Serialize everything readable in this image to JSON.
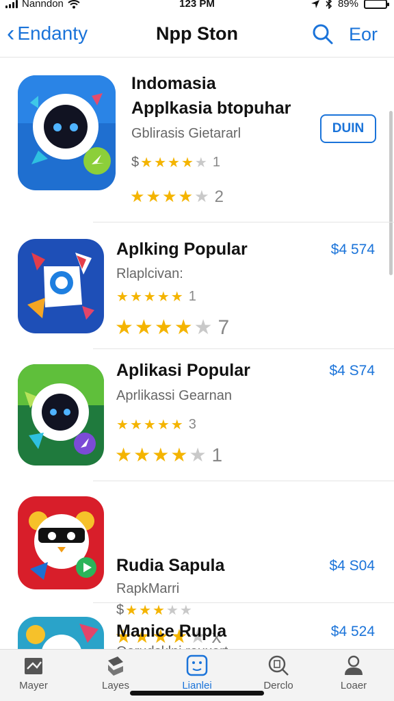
{
  "status": {
    "carrier": "Nanndon",
    "time": "123 PM",
    "battery": "89%",
    "battery_level": 0.89,
    "battery_color": "#2ab41e"
  },
  "nav": {
    "back_label": "Endanty",
    "title": "Npp Ston",
    "edit_label": "Eor",
    "accent": "#1a73d9"
  },
  "apps": [
    {
      "name_line1": "Indomasia",
      "name_line2": "Applkasia btopuhar",
      "subtitle": "Gblirasis Gietararl",
      "rating_a": {
        "prefix": "$",
        "stars": 4,
        "count": "1"
      },
      "rating_b": {
        "prefix": "",
        "stars": 4,
        "count": "2"
      },
      "action": "DUIN"
    },
    {
      "name": "Aplking Popular",
      "subtitle": "Rlaplcivan:",
      "price": "$4 574",
      "rating_a": {
        "prefix": "",
        "stars": 5,
        "count": "1"
      },
      "rating_b": {
        "prefix": "",
        "stars": 4,
        "count": "7"
      }
    },
    {
      "name": "Aplikasi Popular",
      "subtitle": "Aprlikassi Gearnan",
      "price": "$4 S74",
      "rating_a": {
        "prefix": "",
        "stars": 5,
        "count": "3"
      },
      "rating_b": {
        "prefix": "",
        "stars": 4,
        "count": "1"
      }
    },
    {
      "name": "Rudia Sapula",
      "subtitle": "RapkMarri",
      "price": "$4 S04",
      "rating_a": {
        "prefix": "$",
        "stars": 3,
        "count": ""
      },
      "rating_b": {
        "prefix": "",
        "stars": 4,
        "count": "x"
      }
    },
    {
      "name": "Manice Rupla",
      "subtitle": "Oerudsklni rouxert",
      "price": "$4 524"
    }
  ],
  "tabs": [
    {
      "label": "Mayer",
      "icon": "book-icon"
    },
    {
      "label": "Layes",
      "icon": "layers-icon"
    },
    {
      "label": "Lianlei",
      "icon": "apps-icon"
    },
    {
      "label": "Derclo",
      "icon": "search-doc-icon"
    },
    {
      "label": "Loaer",
      "icon": "person-icon"
    }
  ]
}
